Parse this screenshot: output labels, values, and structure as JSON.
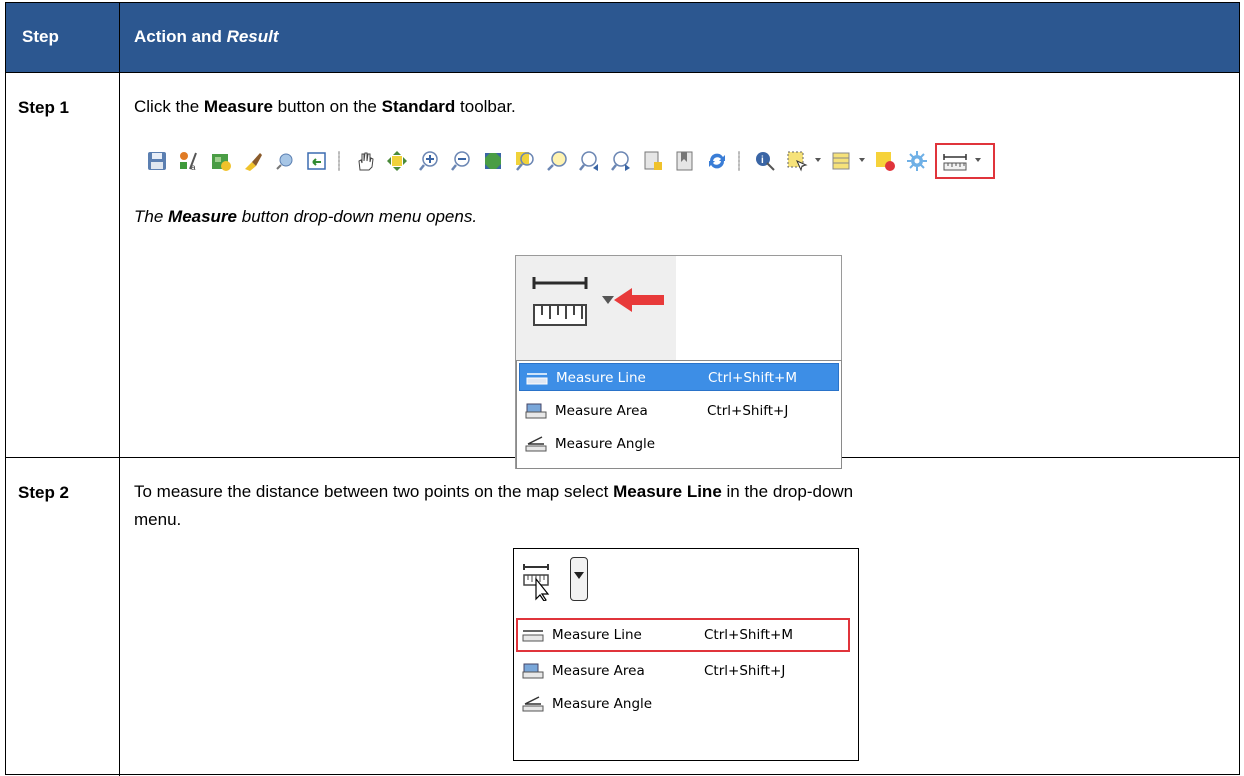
{
  "header": {
    "col_step": "Step",
    "col_action_prefix": "Action and ",
    "col_action_italic": "Result"
  },
  "row1": {
    "step": "Step 1",
    "instr_a": "Click the ",
    "instr_b": "Measure",
    "instr_c": " button on the ",
    "instr_d": "Standard",
    "instr_e": " toolbar.",
    "result_a": "The ",
    "result_b": "Measure",
    "result_c": " button drop-down menu opens.",
    "toolbar_icons": [
      "save-project-icon",
      "style-manager-icon",
      "new-map-icon",
      "brush-icon",
      "help-search-icon",
      "add-layer-icon",
      "pan-icon",
      "pan-to-selection-icon",
      "zoom-in-icon",
      "zoom-out-icon",
      "zoom-full-icon",
      "zoom-to-selection-icon",
      "zoom-to-layer-icon",
      "zoom-last-icon",
      "zoom-next-icon",
      "new-bookmark-icon",
      "show-bookmarks-icon",
      "refresh-icon",
      "identify-icon",
      "select-features-icon",
      "attribute-icon",
      "deselect-icon",
      "settings-icon",
      "measure-icon"
    ],
    "menu": {
      "items": [
        {
          "label": "Measure Line",
          "shortcut": "Ctrl+Shift+M",
          "icon": "measure-line-icon"
        },
        {
          "label": "Measure Area",
          "shortcut": "Ctrl+Shift+J",
          "icon": "measure-area-icon"
        },
        {
          "label": "Measure Angle",
          "shortcut": "",
          "icon": "measure-angle-icon"
        }
      ]
    },
    "colors": {
      "highlight": "#e0343b",
      "selection": "#3d8ee6",
      "header": "#2c5790"
    }
  },
  "row2": {
    "step": "Step 2",
    "instr_a": "To measure the distance between two points on the map select ",
    "instr_b": "Measure Line",
    "instr_c": " in the drop-down",
    "instr_d": "menu.",
    "menu": {
      "items": [
        {
          "label": "Measure Line",
          "shortcut": "Ctrl+Shift+M",
          "icon": "measure-line-icon"
        },
        {
          "label": "Measure Area",
          "shortcut": "Ctrl+Shift+J",
          "icon": "measure-area-icon"
        },
        {
          "label": "Measure Angle",
          "shortcut": "",
          "icon": "measure-angle-icon"
        }
      ]
    }
  }
}
